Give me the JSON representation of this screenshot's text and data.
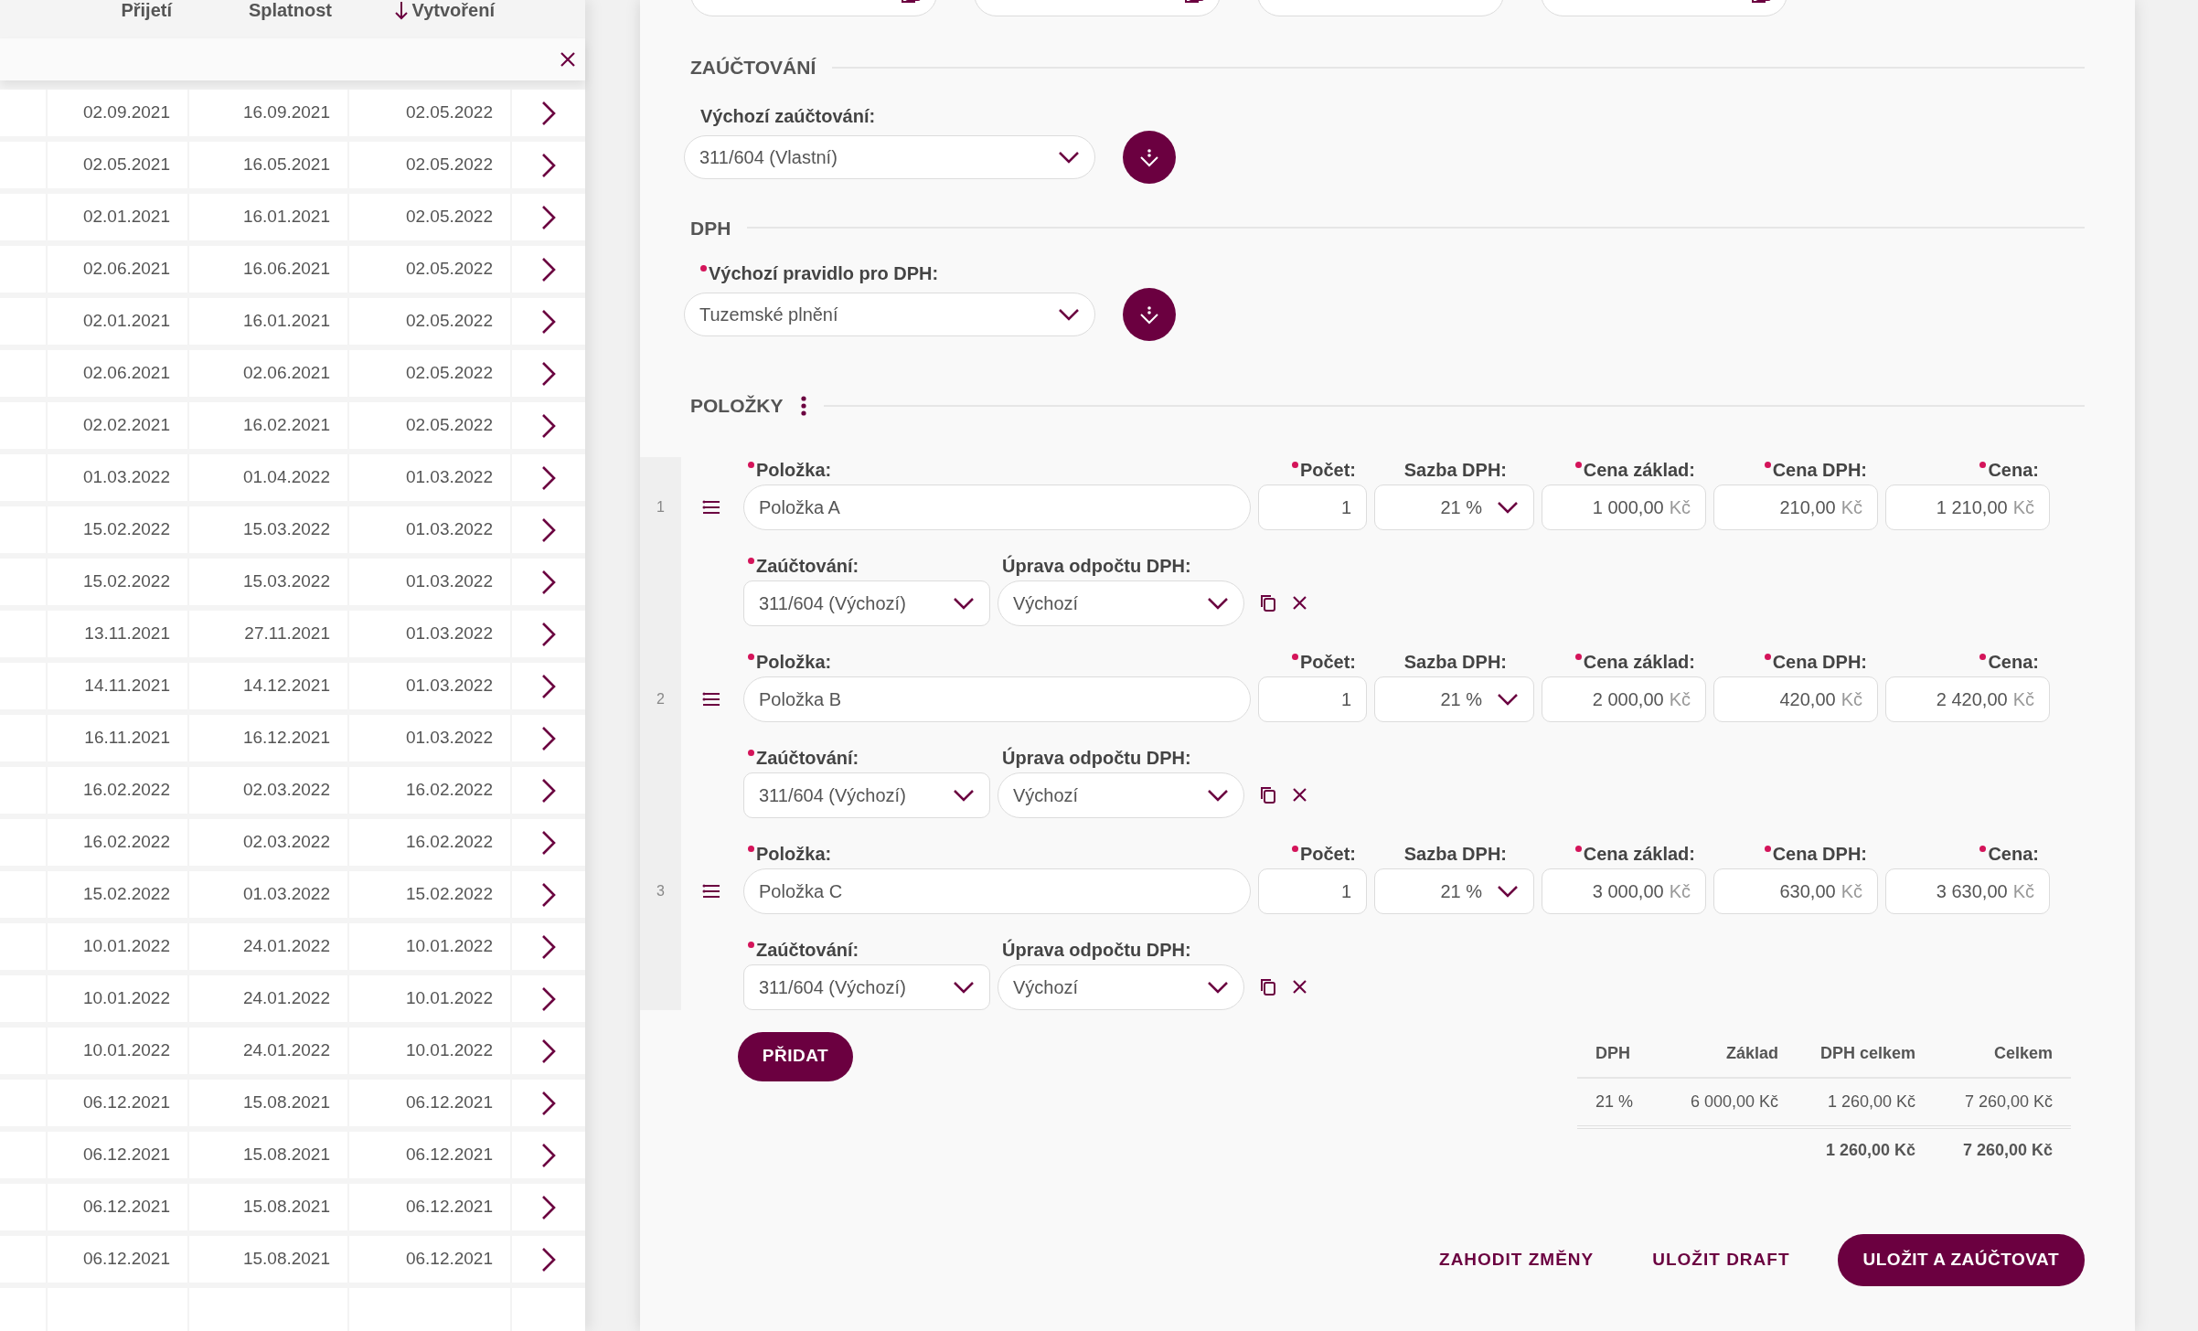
{
  "list": {
    "columns": [
      {
        "label": "Přijetí",
        "sorted": false
      },
      {
        "label": "Splatnost",
        "sorted": false
      },
      {
        "label": "Vytvoření",
        "sorted": true
      }
    ],
    "rows": [
      [
        "02.09.2021",
        "16.09.2021",
        "02.05.2022"
      ],
      [
        "02.05.2021",
        "16.05.2021",
        "02.05.2022"
      ],
      [
        "02.01.2021",
        "16.01.2021",
        "02.05.2022"
      ],
      [
        "02.06.2021",
        "16.06.2021",
        "02.05.2022"
      ],
      [
        "02.01.2021",
        "16.01.2021",
        "02.05.2022"
      ],
      [
        "02.06.2021",
        "02.06.2021",
        "02.05.2022"
      ],
      [
        "02.02.2021",
        "16.02.2021",
        "02.05.2022"
      ],
      [
        "01.03.2022",
        "01.04.2022",
        "01.03.2022"
      ],
      [
        "15.02.2022",
        "15.03.2022",
        "01.03.2022"
      ],
      [
        "15.02.2022",
        "15.03.2022",
        "01.03.2022"
      ],
      [
        "13.11.2021",
        "27.11.2021",
        "01.03.2022"
      ],
      [
        "14.11.2021",
        "14.12.2021",
        "01.03.2022"
      ],
      [
        "16.11.2021",
        "16.12.2021",
        "01.03.2022"
      ],
      [
        "16.02.2022",
        "02.03.2022",
        "16.02.2022"
      ],
      [
        "16.02.2022",
        "02.03.2022",
        "16.02.2022"
      ],
      [
        "15.02.2022",
        "01.03.2022",
        "15.02.2022"
      ],
      [
        "10.01.2022",
        "24.01.2022",
        "10.01.2022"
      ],
      [
        "10.01.2022",
        "24.01.2022",
        "10.01.2022"
      ],
      [
        "10.01.2022",
        "24.01.2022",
        "10.01.2022"
      ],
      [
        "06.12.2021",
        "15.08.2021",
        "06.12.2021"
      ],
      [
        "06.12.2021",
        "15.08.2021",
        "06.12.2021"
      ],
      [
        "06.12.2021",
        "15.08.2021",
        "06.12.2021"
      ],
      [
        "06.12.2021",
        "15.08.2021",
        "06.12.2021"
      ]
    ]
  },
  "top_fields": [
    {
      "kind": "date"
    },
    {
      "kind": "date"
    },
    {
      "kind": "text"
    },
    {
      "kind": "date"
    }
  ],
  "posting": {
    "heading": "ZAÚČTOVÁNÍ",
    "label": "Výchozí zaúčtování:",
    "required": false,
    "value": "311/604 (Vlastní)"
  },
  "vat": {
    "heading": "DPH",
    "label": "Výchozí pravidlo pro DPH:",
    "required": true,
    "value": "Tuzemské plnění"
  },
  "items_section": {
    "heading": "POLOŽKY",
    "items": [
      {
        "number": "1",
        "fields": [
          {
            "kind": "text",
            "label": "Položka:",
            "required": true,
            "value": "Položka A"
          },
          {
            "kind": "number",
            "label": "Počet:",
            "required": true,
            "value": "1"
          },
          {
            "kind": "select",
            "label": "Sazba DPH:",
            "required": false,
            "value": "21 %"
          },
          {
            "kind": "money",
            "label": "Cena základ:",
            "required": true,
            "value": "1 000,00",
            "unit": "Kč"
          },
          {
            "kind": "money",
            "label": "Cena DPH:",
            "required": true,
            "value": "210,00",
            "unit": "Kč"
          },
          {
            "kind": "money",
            "label": "Cena:",
            "required": true,
            "value": "1 210,00",
            "unit": "Kč"
          }
        ],
        "fields_2": [
          {
            "label": "Zaúčtování:",
            "required": true,
            "value": "311/604 (Výchozí)"
          },
          {
            "label": "Úprava odpočtu DPH:",
            "required": false,
            "value": "Výchozí"
          }
        ]
      },
      {
        "number": "2",
        "fields": [
          {
            "kind": "text",
            "label": "Položka:",
            "required": true,
            "value": "Položka B"
          },
          {
            "kind": "number",
            "label": "Počet:",
            "required": true,
            "value": "1"
          },
          {
            "kind": "select",
            "label": "Sazba DPH:",
            "required": false,
            "value": "21 %"
          },
          {
            "kind": "money",
            "label": "Cena základ:",
            "required": true,
            "value": "2 000,00",
            "unit": "Kč"
          },
          {
            "kind": "money",
            "label": "Cena DPH:",
            "required": true,
            "value": "420,00",
            "unit": "Kč"
          },
          {
            "kind": "money",
            "label": "Cena:",
            "required": true,
            "value": "2 420,00",
            "unit": "Kč"
          }
        ],
        "fields_2": [
          {
            "label": "Zaúčtování:",
            "required": true,
            "value": "311/604 (Výchozí)"
          },
          {
            "label": "Úprava odpočtu DPH:",
            "required": false,
            "value": "Výchozí"
          }
        ]
      },
      {
        "number": "3",
        "fields": [
          {
            "kind": "text",
            "label": "Položka:",
            "required": true,
            "value": "Položka C"
          },
          {
            "kind": "number",
            "label": "Počet:",
            "required": true,
            "value": "1"
          },
          {
            "kind": "select",
            "label": "Sazba DPH:",
            "required": false,
            "value": "21 %"
          },
          {
            "kind": "money",
            "label": "Cena základ:",
            "required": true,
            "value": "3 000,00",
            "unit": "Kč"
          },
          {
            "kind": "money",
            "label": "Cena DPH:",
            "required": true,
            "value": "630,00",
            "unit": "Kč"
          },
          {
            "kind": "money",
            "label": "Cena:",
            "required": true,
            "value": "3 630,00",
            "unit": "Kč"
          }
        ],
        "fields_2": [
          {
            "label": "Zaúčtování:",
            "required": true,
            "value": "311/604 (Výchozí)"
          },
          {
            "label": "Úprava odpočtu DPH:",
            "required": false,
            "value": "Výchozí"
          }
        ]
      }
    ]
  },
  "add_button": "PŘIDAT",
  "vat_summary": {
    "columns": [
      "DPH",
      "Základ",
      "DPH celkem",
      "Celkem"
    ],
    "rows": [
      [
        "21 %",
        "6 000,00 Kč",
        "1 260,00 Kč",
        "7 260,00 Kč"
      ]
    ],
    "totals": {
      "vat_total": "1 260,00 Kč",
      "total": "7 260,00 Kč"
    }
  },
  "actions": [
    {
      "kind": "text",
      "label": "ZAHODIT ZMĚNY"
    },
    {
      "kind": "text",
      "label": "ULOŽIT DRAFT"
    },
    {
      "kind": "primary",
      "label": "ULOŽIT A ZAÚČTOVAT"
    }
  ]
}
